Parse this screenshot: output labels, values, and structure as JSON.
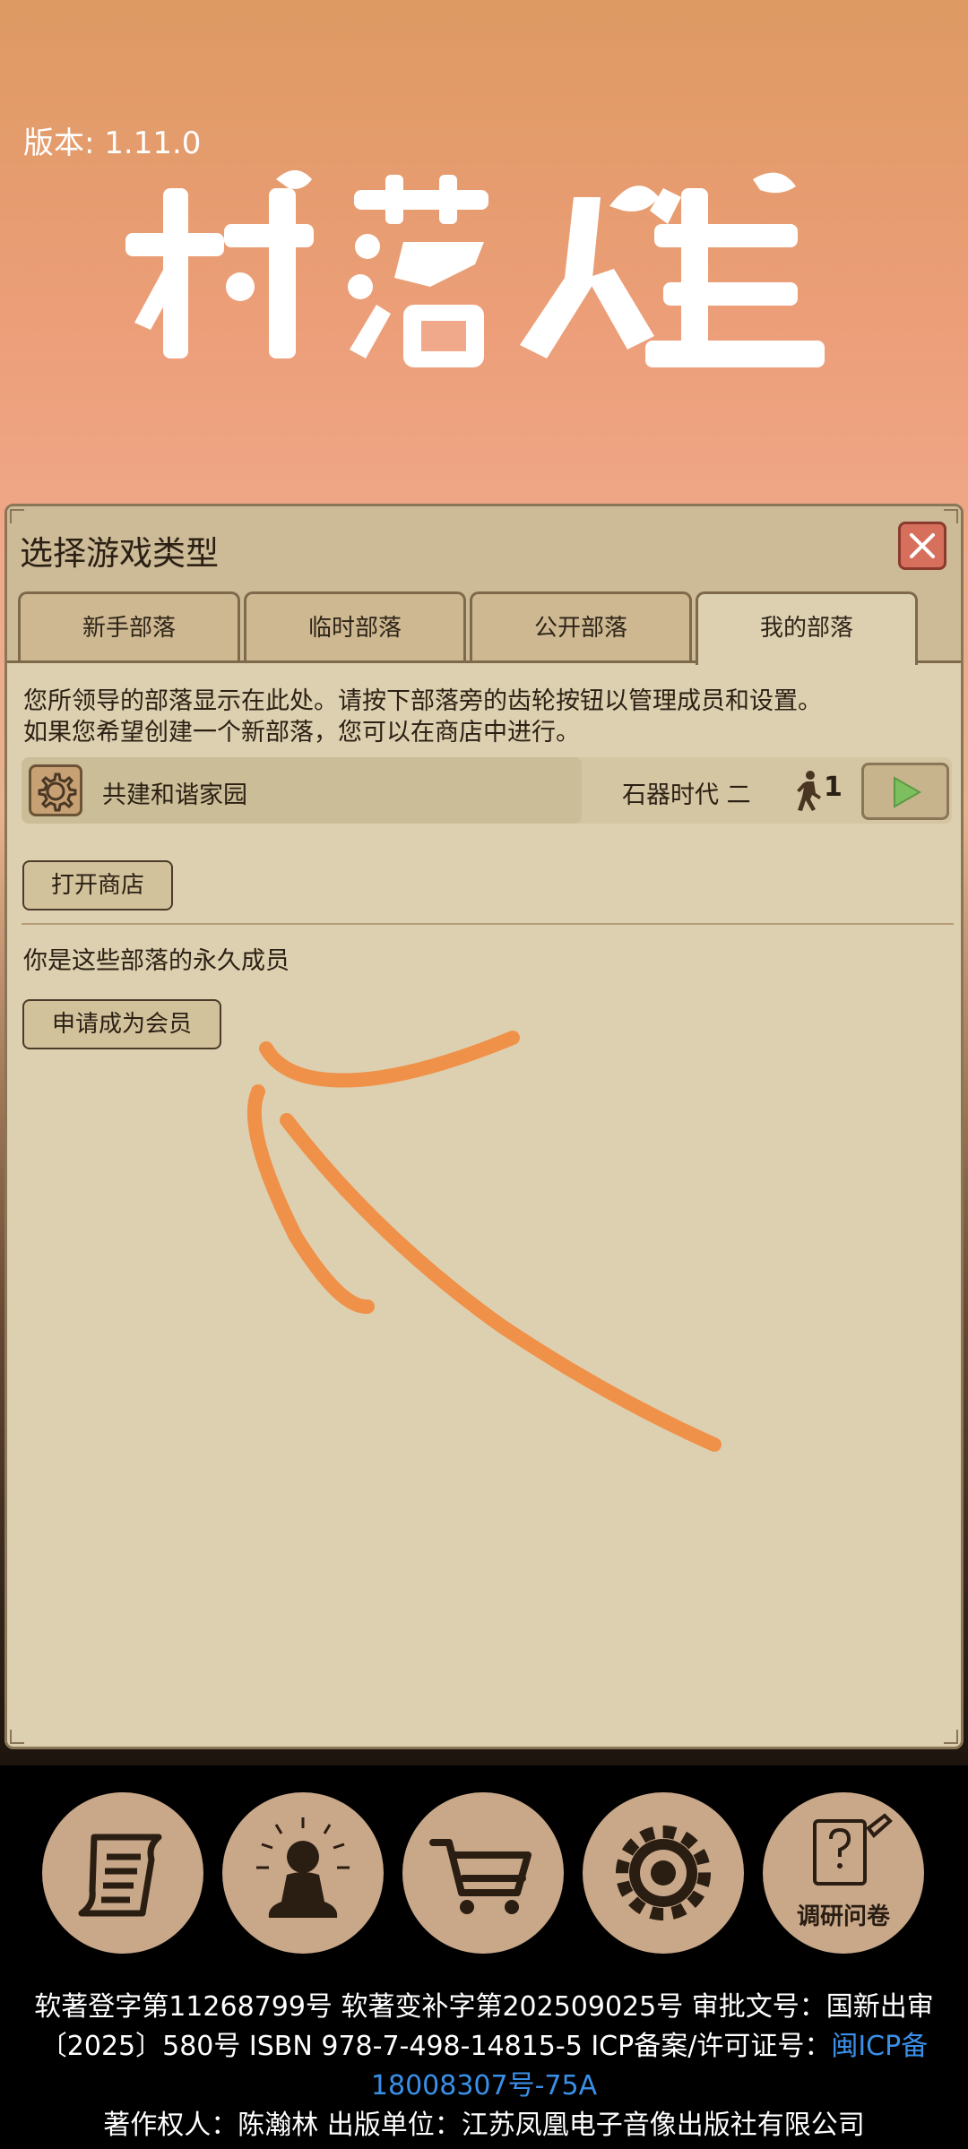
{
  "version": "版本: 1.11.0",
  "logo_text": "村落人生",
  "dialog": {
    "title": "选择游戏类型",
    "tabs": [
      {
        "label": "新手部落",
        "active": false
      },
      {
        "label": "临时部落",
        "active": false
      },
      {
        "label": "公开部落",
        "active": false
      },
      {
        "label": "我的部落",
        "active": true
      }
    ],
    "description_line1": "您所领导的部落显示在此处。请按下部落旁的齿轮按钮以管理成员和设置。",
    "description_line2": "如果您希望创建一个新部落，您可以在商店中进行。",
    "tribe": {
      "name": "共建和谐家园",
      "era": "石器时代 二",
      "member_count": "1"
    },
    "open_shop_label": "打开商店",
    "member_section_text": "你是这些部落的永久成员",
    "apply_member_label": "申请成为会员"
  },
  "bottom_nav": {
    "items": [
      {
        "icon": "scroll-icon"
      },
      {
        "icon": "meditation-icon"
      },
      {
        "icon": "cart-icon"
      },
      {
        "icon": "gear-icon"
      },
      {
        "icon": "survey-icon",
        "label": "调研问卷"
      }
    ]
  },
  "footer": {
    "line1": "软著登字第11268799号 软著变补字第202509025号 审批文号：国新出审",
    "line2_prefix": "〔2025〕580号 ISBN 978-7-498-14815-5 ICP备案/许可证号：",
    "line2_link": "闽ICP备",
    "line3_link": "18008307号-75A",
    "line4": "著作权人：陈瀚林 出版单位：江苏凤凰电子音像出版社有限公司"
  },
  "colors": {
    "panel_bg": "#ddd0b0",
    "close_red": "#d6705c",
    "play_green": "#7dbf5e",
    "annotation_orange": "#f0914a",
    "link_blue": "#3a8fe8"
  }
}
